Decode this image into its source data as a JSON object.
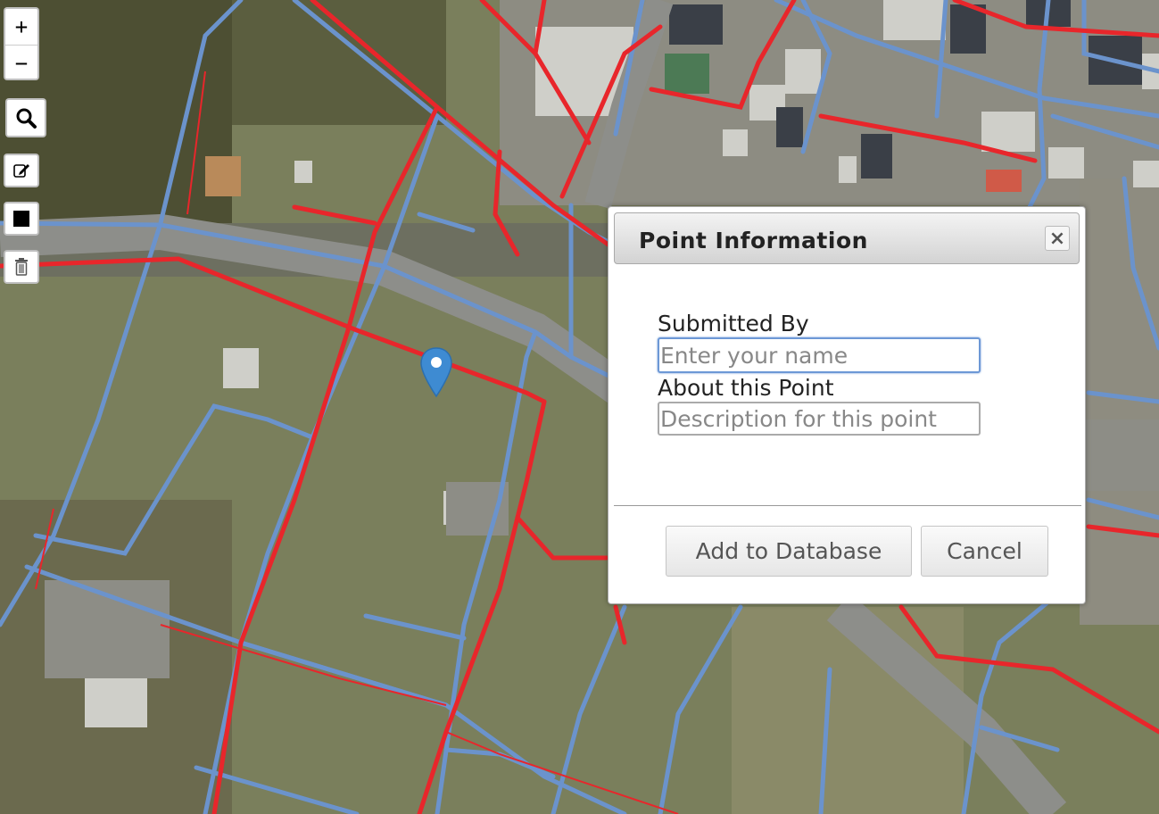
{
  "map": {
    "controls": {
      "zoom_in_label": "+",
      "zoom_out_label": "−"
    },
    "colors": {
      "red_lines": "#e8262b",
      "blue_lines": "#6b93cc",
      "marker": "#3e8bd2"
    }
  },
  "dialog": {
    "title": "Point Information",
    "close_label": "×",
    "fields": {
      "submitted_by_label": "Submitted By",
      "submitted_by_placeholder": "Enter your name",
      "about_label": "About this Point",
      "about_placeholder": "Description for this point"
    },
    "buttons": {
      "add_label": "Add to Database",
      "cancel_label": "Cancel"
    }
  }
}
